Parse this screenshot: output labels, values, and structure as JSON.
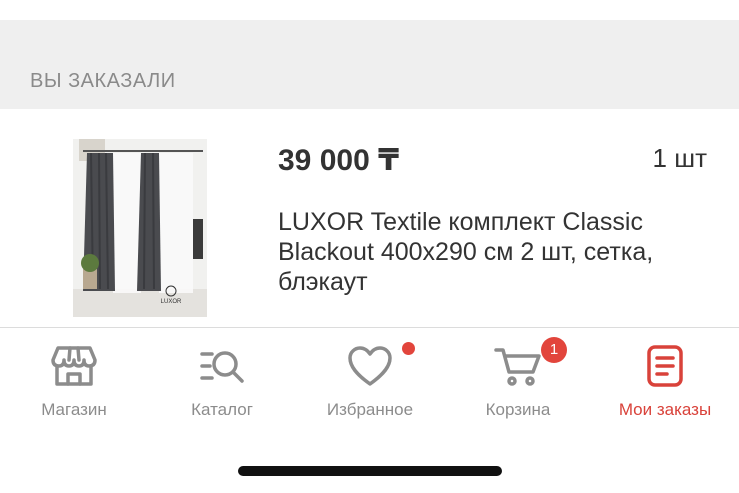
{
  "section": {
    "title": "ВЫ ЗАКАЗАЛИ"
  },
  "order_item": {
    "price": "39 000 ₸",
    "quantity": "1 шт",
    "name": "LUXOR Textile комплект Classic Blackout 400х290 см 2 шт, сетка, блэкаут"
  },
  "tabbar": {
    "tabs": [
      {
        "label": "Магазин",
        "icon": "shop-icon",
        "active": false
      },
      {
        "label": "Каталог",
        "icon": "catalog-search-icon",
        "active": false
      },
      {
        "label": "Избранное",
        "icon": "heart-icon",
        "active": false,
        "badge": "dot"
      },
      {
        "label": "Корзина",
        "icon": "cart-icon",
        "active": false,
        "badge_count": "1"
      },
      {
        "label": "Мои заказы",
        "icon": "orders-icon",
        "active": true
      }
    ]
  },
  "colors": {
    "accent": "#d9423a",
    "inactive": "#8c8c8c",
    "badge": "#e2453c",
    "header_bg": "#efefef"
  }
}
